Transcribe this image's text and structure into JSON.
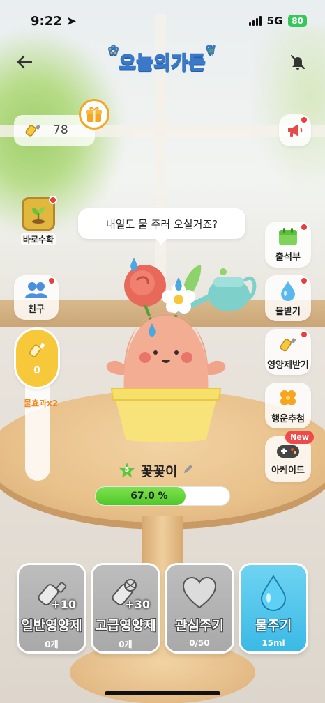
{
  "status_bar": {
    "time": "9:22",
    "network": "5G",
    "battery": "80"
  },
  "header": {
    "logo_text": "오늘의가든"
  },
  "points": {
    "value": "78"
  },
  "left_buttons": {
    "harvest_label": "바로수확",
    "friends_label": "친구"
  },
  "speech_bubble": "내일도 물 주러 오실거죠?",
  "right_buttons": [
    {
      "label": "출석부",
      "icon": "calendar-icon"
    },
    {
      "label": "물받기",
      "icon": "water-drop-icon"
    },
    {
      "label": "영양제받기",
      "icon": "nutrient-icon"
    },
    {
      "label": "행운추첨",
      "icon": "clover-icon"
    },
    {
      "label": "아케이드",
      "icon": "gamepad-icon",
      "badge": "New"
    }
  ],
  "gauge": {
    "value": "0",
    "note": "물효과x2"
  },
  "plant": {
    "level": "5",
    "name": "꽃꽃이",
    "progress_text": "67.0 %",
    "progress_value": 67.0
  },
  "actions": [
    {
      "title": "일반영양제",
      "bonus": "+10",
      "count": "0개",
      "icon": "nutrient-bottle-icon"
    },
    {
      "title": "고급영양제",
      "bonus": "+30",
      "count": "0개",
      "icon": "premium-nutrient-icon"
    },
    {
      "title": "관심주기",
      "count": "0/50",
      "icon": "heart-icon"
    },
    {
      "title": "물주기",
      "count": "15ml",
      "icon": "water-drop-icon"
    }
  ],
  "colors": {
    "accent": "#3ab9e6",
    "progress": "#4fc828",
    "badge": "#ee3b3b",
    "gauge": "#f7c83a"
  }
}
